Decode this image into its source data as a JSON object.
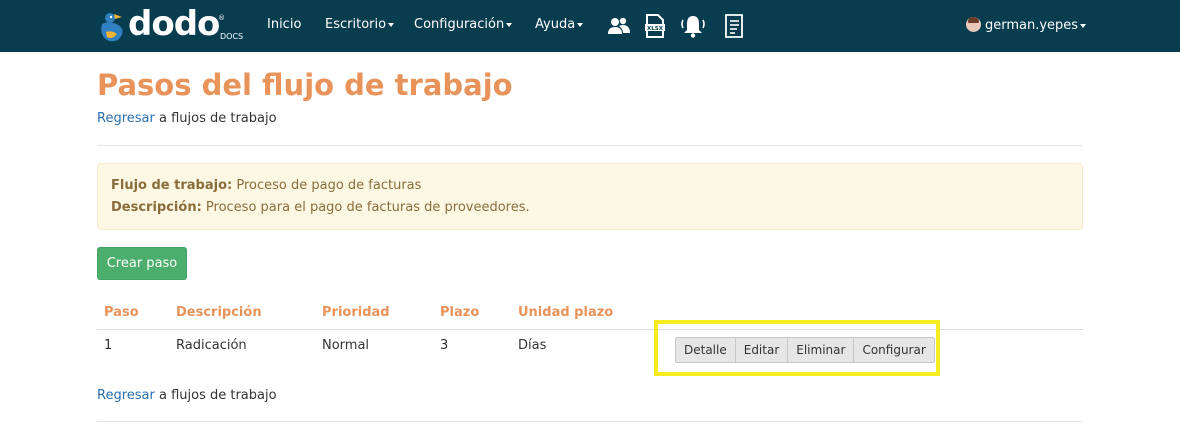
{
  "brand": {
    "name": "dodo",
    "sub": "DOCS",
    "reg": "®"
  },
  "nav": {
    "items": [
      {
        "label": "Inicio",
        "dropdown": false
      },
      {
        "label": "Escritorio",
        "dropdown": true
      },
      {
        "label": "Configuración",
        "dropdown": true
      },
      {
        "label": "Ayuda",
        "dropdown": true
      }
    ],
    "icons": [
      "users-icon",
      "xlsx-file-icon",
      "bell-icon",
      "document-list-icon"
    ],
    "user": "german.yepes"
  },
  "page": {
    "title": "Pasos del flujo de trabajo",
    "back_link": "Regresar",
    "back_text": " a flujos de trabajo"
  },
  "info": {
    "workflow_label": "Flujo de trabajo:",
    "workflow_value": " Proceso de pago de facturas",
    "description_label": "Descripción:",
    "description_value": " Proceso para el pago de facturas de proveedores."
  },
  "actions": {
    "create_step": "Crear paso"
  },
  "table": {
    "headers": [
      "Paso",
      "Descripción",
      "Prioridad",
      "Plazo",
      "Unidad plazo"
    ],
    "rows": [
      {
        "paso": "1",
        "descripcion": "Radicación",
        "prioridad": "Normal",
        "plazo": "3",
        "unidad": "Días"
      }
    ],
    "row_buttons": [
      "Detalle",
      "Editar",
      "Eliminar",
      "Configurar"
    ]
  },
  "colors": {
    "navbar": "#073d4f",
    "title": "#e8935a",
    "link": "#2a6fb0",
    "success": "#4cae6c",
    "highlight": "#f6ec1f"
  }
}
